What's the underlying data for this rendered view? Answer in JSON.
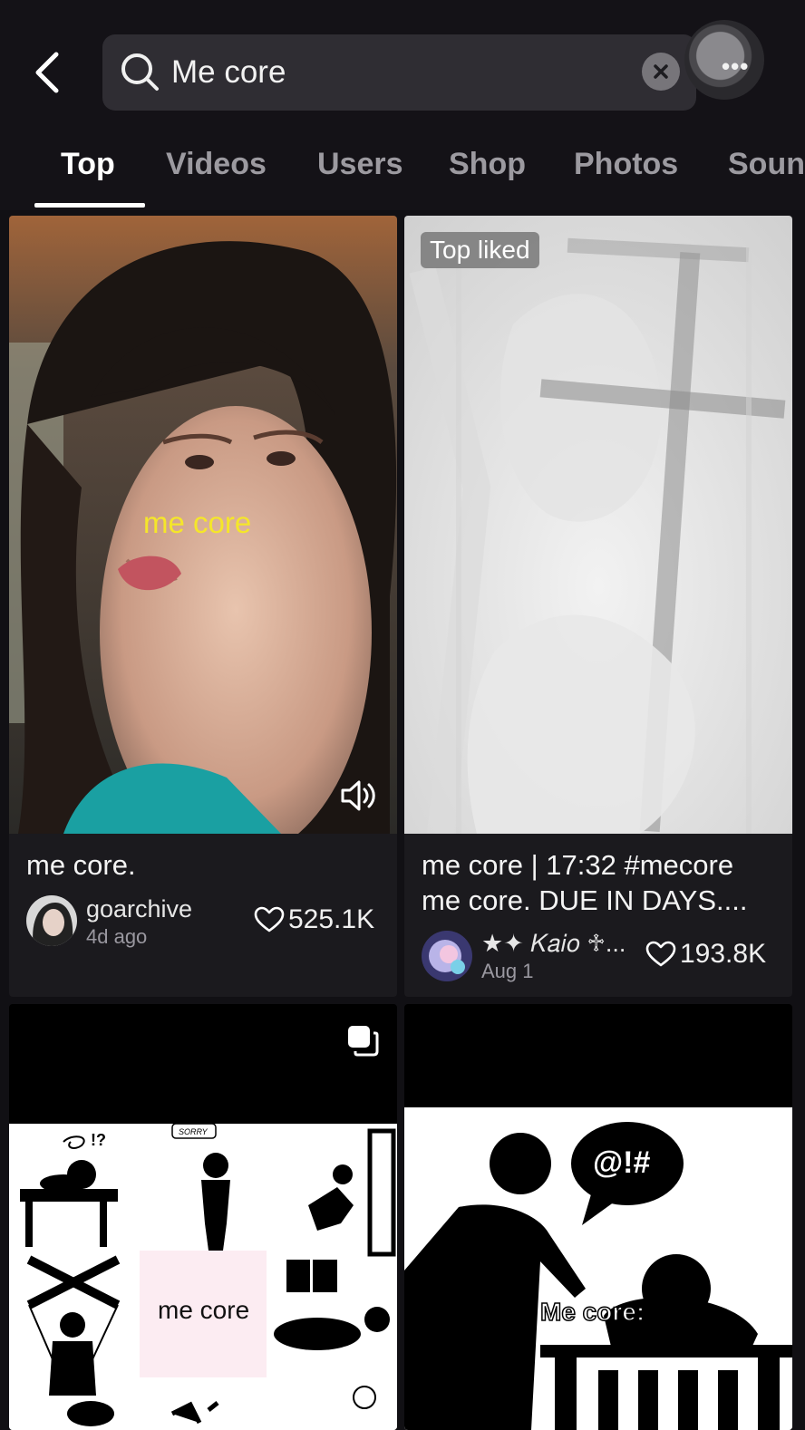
{
  "search": {
    "query": "Me core"
  },
  "tabs": [
    {
      "label": "Top",
      "active": true
    },
    {
      "label": "Videos",
      "active": false
    },
    {
      "label": "Users",
      "active": false
    },
    {
      "label": "Shop",
      "active": false
    },
    {
      "label": "Photos",
      "active": false
    },
    {
      "label": "Soun",
      "active": false
    }
  ],
  "results": [
    {
      "overlay_text": "me core",
      "caption": "me core.",
      "author": "goarchive",
      "date": "4d ago",
      "likes": "525.1K"
    },
    {
      "badge": "Top liked",
      "caption_line1": "me core | 17:32 #mecore",
      "caption_line2": "me core. DUE IN DAYS....",
      "author": "★✦ 𝐾𝑎𝑖𝑜 ♱...",
      "date": "Aug 1",
      "likes": "193.8K"
    },
    {
      "overlay_text": "me core"
    },
    {
      "speech_bubble": "@!#",
      "overlay_text": "Me core:"
    }
  ],
  "colors": {
    "accent_yellow": "#f5e62a",
    "background": "#111014",
    "card": "#1b1a1e"
  },
  "icons": [
    "back-arrow-icon",
    "search-icon",
    "clear-icon",
    "more-icon",
    "sound-icon",
    "heart-icon",
    "carousel-icon"
  ]
}
